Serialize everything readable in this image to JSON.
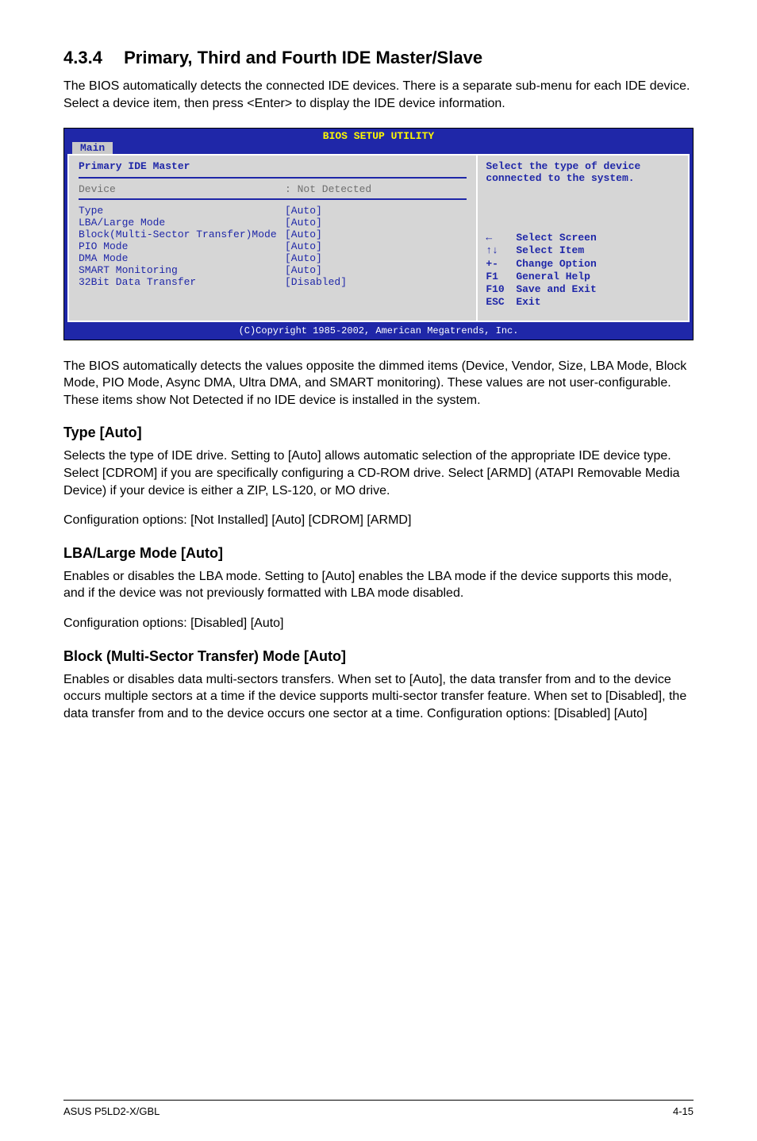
{
  "section": {
    "number": "4.3.4",
    "title": "Primary, Third and Fourth IDE Master/Slave"
  },
  "intro": "The BIOS automatically detects the connected IDE devices. There is a separate sub-menu for each IDE device. Select a device item, then press <Enter> to display the IDE device information.",
  "bios": {
    "title": "BIOS SETUP UTILITY",
    "tab": "Main",
    "subheader": "Primary IDE Master",
    "device_label": "Device",
    "device_value": ": Not Detected",
    "items": [
      {
        "label": "Type",
        "value": "[Auto]"
      },
      {
        "label": "LBA/Large Mode",
        "value": "[Auto]"
      },
      {
        "label": "Block(Multi-Sector Transfer)Mode",
        "value": "[Auto]"
      },
      {
        "label": "PIO Mode",
        "value": "[Auto]"
      },
      {
        "label": "DMA Mode",
        "value": "[Auto]"
      },
      {
        "label": "SMART Monitoring",
        "value": "[Auto]"
      },
      {
        "label": "32Bit Data Transfer",
        "value": "[Disabled]"
      }
    ],
    "help_top": "Select the type of device connected to the system.",
    "nav": [
      {
        "key": "←",
        "label": "Select Screen",
        "icon": "arrow-left-icon"
      },
      {
        "key": "↑↓",
        "label": "Select Item",
        "icon": "arrow-updown-icon"
      },
      {
        "key": "+-",
        "label": "Change Option",
        "icon": "plusminus-icon"
      },
      {
        "key": "F1",
        "label": "General Help",
        "icon": "f1-icon"
      },
      {
        "key": "F10",
        "label": "Save and Exit",
        "icon": "f10-icon"
      },
      {
        "key": "ESC",
        "label": "Exit",
        "icon": "esc-icon"
      }
    ],
    "footer": "(C)Copyright 1985-2002, American Megatrends, Inc."
  },
  "after_bios": "The BIOS automatically detects the values opposite the dimmed items (Device, Vendor, Size, LBA Mode, Block Mode, PIO Mode, Async DMA, Ultra DMA, and SMART monitoring). These values are not user-configurable. These items show Not Detected if no IDE device is installed in the system.",
  "type": {
    "heading": "Type [Auto]",
    "body": "Selects the type of IDE drive. Setting to [Auto] allows automatic selection of the appropriate IDE device type. Select [CDROM] if you are specifically configuring a CD-ROM drive. Select [ARMD] (ATAPI Removable Media Device) if your device is either a ZIP, LS-120, or MO drive.",
    "opts": "Configuration options: [Not Installed] [Auto] [CDROM] [ARMD]"
  },
  "lba": {
    "heading": "LBA/Large Mode [Auto]",
    "body": "Enables or disables the LBA mode. Setting to [Auto] enables the LBA mode if the device supports this mode, and if the device was not previously formatted with LBA mode disabled.",
    "opts": "Configuration options: [Disabled] [Auto]"
  },
  "block": {
    "heading": "Block (Multi-Sector Transfer) Mode [Auto]",
    "body": "Enables or disables data multi-sectors transfers. When set to [Auto], the data transfer from and to the device occurs multiple sectors at a time if the device supports multi-sector transfer feature. When set to [Disabled], the data transfer from and to the device occurs one sector at a time. Configuration options: [Disabled] [Auto]"
  },
  "footer": {
    "left": "ASUS P5LD2-X/GBL",
    "right": "4-15"
  }
}
